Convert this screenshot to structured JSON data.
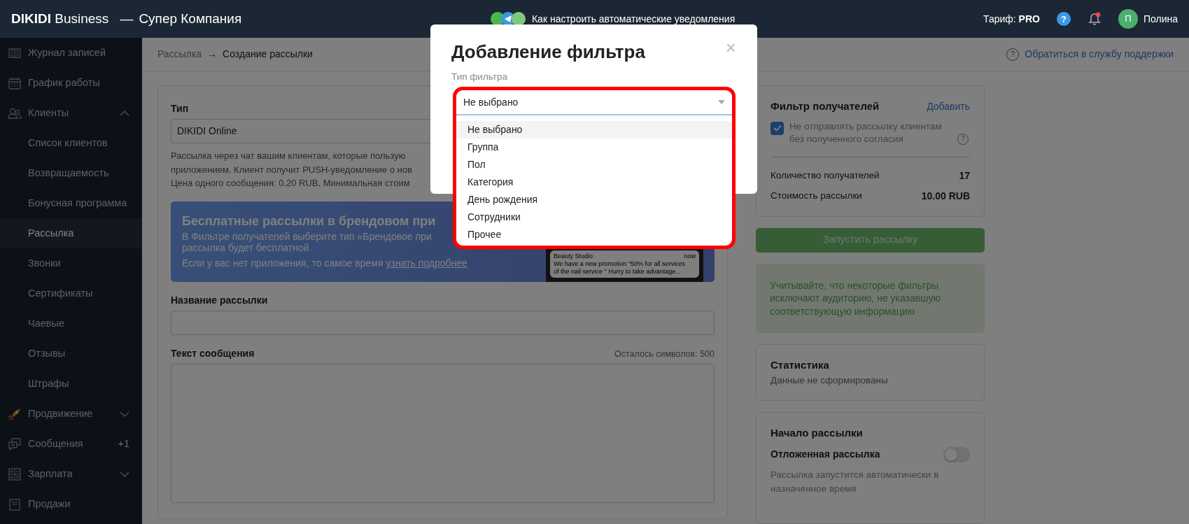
{
  "header": {
    "brand_bold": "DIKIDI",
    "brand": "Business",
    "separator": "—",
    "company": "Супер Компания",
    "promo": "Как настроить автоматические уведомления",
    "plan_label": "Тариф:",
    "plan": "PRO",
    "help_mark": "?",
    "notifications_unread": true,
    "avatar_letter": "П",
    "user": "Полина"
  },
  "sidebar": {
    "items": [
      {
        "label": "Журнал записей",
        "selected": false
      },
      {
        "label": "График работы",
        "selected": false
      },
      {
        "label": "Клиенты",
        "selected": false,
        "expanded": true,
        "children": [
          {
            "label": "Список клиентов",
            "selected": false
          },
          {
            "label": "Возвращаемость",
            "selected": false
          },
          {
            "label": "Бонусная программа",
            "selected": false
          },
          {
            "label": "Рассылка",
            "selected": true
          },
          {
            "label": "Звонки",
            "selected": false
          },
          {
            "label": "Сертификаты",
            "selected": false
          },
          {
            "label": "Чаевые",
            "selected": false
          },
          {
            "label": "Отзывы",
            "selected": false
          },
          {
            "label": "Штрафы",
            "selected": false
          }
        ]
      },
      {
        "label": "Продвижение",
        "selected": false,
        "expanded": false
      },
      {
        "label": "Сообщения",
        "selected": false,
        "badge": "+1"
      },
      {
        "label": "Зарплата",
        "selected": false,
        "expanded": false
      },
      {
        "label": "Продажи",
        "selected": false
      }
    ]
  },
  "breadcrumb": {
    "items": [
      "Рассылка",
      "Создание рассылки"
    ],
    "separator": "→",
    "help_mark": "?",
    "support_link": "Обратиться в службу поддержки"
  },
  "form": {
    "type_label": "Тип",
    "type_value": "DIKIDI Online",
    "description": [
      "Рассылка через чат вашим клиентам, которые пользую",
      "приложением. Клиент получит PUSH-уведомление о нов",
      "Цена одного сообщения: 0.20 RUB. Минимальная стоим"
    ],
    "banner": {
      "title": "Бесплатные рассылки в брендовом при",
      "lines": [
        "В Фильтре получателей выберите тип «Брендовое при",
        "рассылка будет бесплатной"
      ],
      "link_prefix": "Если у вас нет приложения, то самое время",
      "link": "узнать подробнее",
      "phone": {
        "app": "Beauty Studio",
        "time": "now",
        "message": [
          "We have a new promotion \"50% for all services",
          "of the nail service \" Hurry to take advantage..."
        ]
      }
    },
    "name_label": "Название рассылки",
    "text_label": "Текст сообщения",
    "chars_left": "Осталось символов: 500"
  },
  "recipients": {
    "title": "Фильтр получателей",
    "add": "Добавить",
    "consent": {
      "label": "Не отправлять рассылку клиентам без полученного согласия",
      "checked": true,
      "help_mark": "?"
    },
    "stats": [
      {
        "label": "Количество получателей",
        "value": "17"
      },
      {
        "label": "Стоимость рассылки",
        "value": "10.00 RUB"
      }
    ]
  },
  "launch_button": "Запустить рассылку",
  "notice": "Учитывайте, что некоторые фильтры исключают аудиторию, не указавшую соответствующую информацию",
  "statistics": {
    "title": "Статистика",
    "text": "Данные не сформированы"
  },
  "start": {
    "title": "Начало рассылки",
    "delayed_label": "Отложенная рассылка",
    "delayed_on": false,
    "hint": "Рассылка запустится автоматически в назначенное время"
  },
  "modal": {
    "title": "Добавление фильтра",
    "close": "×",
    "field_label": "Тип фильтра",
    "value": "Не выбрано",
    "options": [
      {
        "label": "Не выбрано",
        "selected": true
      },
      {
        "label": "Группа",
        "selected": false
      },
      {
        "label": "Пол",
        "selected": false
      },
      {
        "label": "Категория",
        "selected": false
      },
      {
        "label": "День рождения",
        "selected": false
      },
      {
        "label": "Сотрудники",
        "selected": false
      },
      {
        "label": "Прочее",
        "selected": false
      }
    ]
  }
}
